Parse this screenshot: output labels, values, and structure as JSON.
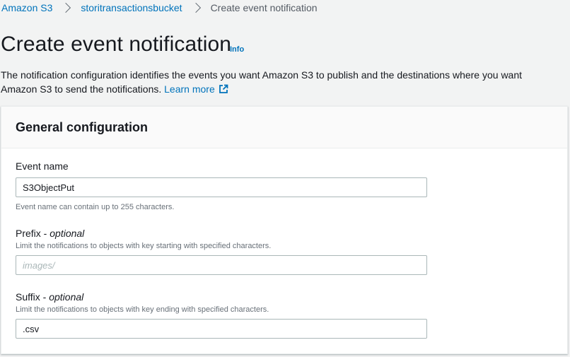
{
  "breadcrumb": {
    "items": [
      "Amazon S3",
      "storitransactionsbucket"
    ],
    "current": "Create event notification"
  },
  "header": {
    "title": "Create event notification",
    "info_label": "Info"
  },
  "description": {
    "text": "The notification configuration identifies the events you want Amazon S3 to publish and the destinations where you want Amazon S3 to send the notifications.",
    "learn_more": "Learn more",
    "learn_more_icon": "external-link-icon"
  },
  "general_config": {
    "title": "General configuration",
    "event_name": {
      "label": "Event name",
      "value": "S3ObjectPut",
      "help": "Event name can contain up to 255 characters."
    },
    "prefix": {
      "label": "Prefix",
      "optional": "optional",
      "help": "Limit the notifications to objects with key starting with specified characters.",
      "value": "",
      "placeholder": "images/"
    },
    "suffix": {
      "label": "Suffix",
      "optional": "optional",
      "help": "Limit the notifications to objects with key ending with specified characters.",
      "value": ".csv",
      "placeholder": ""
    }
  },
  "colors": {
    "link": "#0073bb",
    "background": "#f2f3f3",
    "panel_header": "#fafafa",
    "input_border": "#aab7b8"
  }
}
